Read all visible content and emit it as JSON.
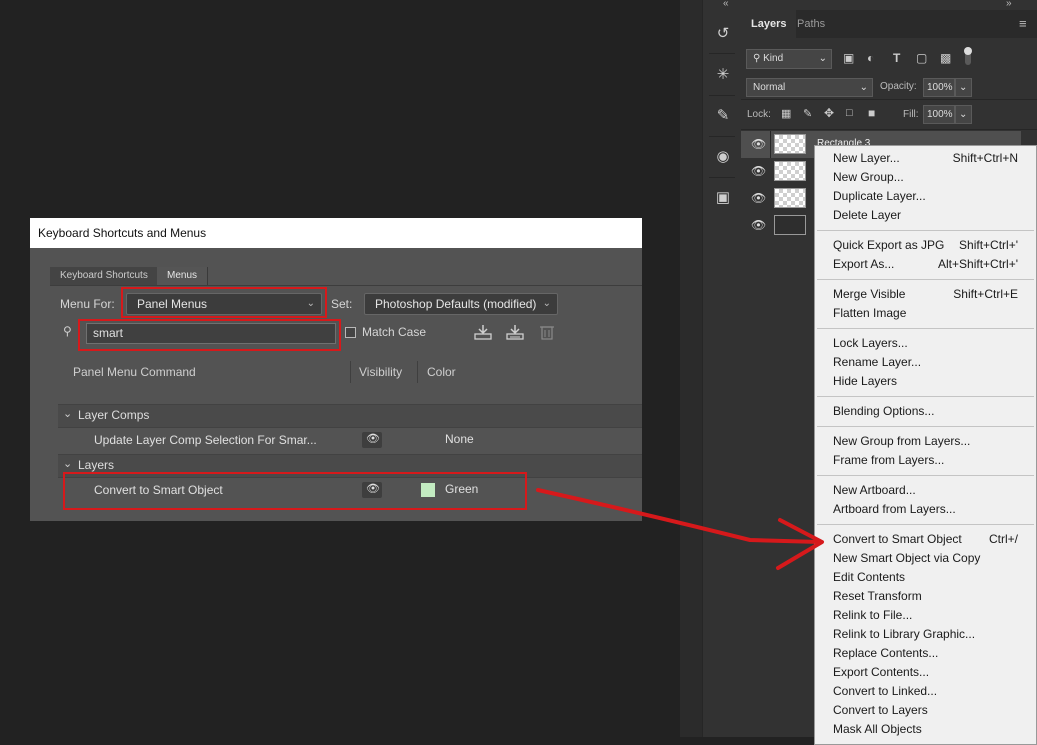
{
  "dialog": {
    "title": "Keyboard Shortcuts and Menus",
    "tabs": [
      "Keyboard Shortcuts",
      "Menus"
    ],
    "menu_for_label": "Menu For:",
    "menu_for_value": "Panel Menus",
    "set_label": "Set:",
    "set_value": "Photoshop Defaults (modified)",
    "search_value": "smart",
    "match_case_label": "Match Case",
    "columns": [
      "Panel Menu Command",
      "Visibility",
      "Color"
    ],
    "groups": [
      {
        "name": "Layer Comps",
        "items": [
          {
            "command": "Update Layer Comp Selection For Smar...",
            "color": "None"
          }
        ]
      },
      {
        "name": "Layers",
        "items": [
          {
            "command": "Convert to Smart Object",
            "color": "Green"
          }
        ]
      }
    ],
    "green_hex": "#c3ebc1",
    "highlight_color": "#d6191b"
  },
  "ps": {
    "tabs": [
      "Layers",
      "Paths"
    ],
    "kind_label": "Kind",
    "blend_mode": "Normal",
    "opacity_label": "Opacity:",
    "opacity_value": "100%",
    "lock_label": "Lock:",
    "fill_label": "Fill:",
    "fill_value": "100%",
    "layer_name": "Rectangle 3",
    "collapse_icon": "double-chevron-icon",
    "panel_menu_icon": "hamburger-icon"
  },
  "context_menu": {
    "items": [
      {
        "label": "New Layer...",
        "shortcut": "Shift+Ctrl+N"
      },
      {
        "label": "New Group...",
        "shortcut": ""
      },
      {
        "label": "Duplicate Layer...",
        "shortcut": ""
      },
      {
        "label": "Delete Layer",
        "shortcut": ""
      },
      {
        "label": "Quick Export as JPG",
        "shortcut": "Shift+Ctrl+'"
      },
      {
        "label": "Export As...",
        "shortcut": "Alt+Shift+Ctrl+'"
      },
      {
        "label": "Merge Visible",
        "shortcut": "Shift+Ctrl+E"
      },
      {
        "label": "Flatten Image",
        "shortcut": ""
      },
      {
        "label": "Lock Layers...",
        "shortcut": ""
      },
      {
        "label": "Rename Layer...",
        "shortcut": ""
      },
      {
        "label": "Hide Layers",
        "shortcut": ""
      },
      {
        "label": "Blending Options...",
        "shortcut": ""
      },
      {
        "label": "New Group from Layers...",
        "shortcut": ""
      },
      {
        "label": "Frame from Layers...",
        "shortcut": ""
      },
      {
        "label": "New Artboard...",
        "shortcut": ""
      },
      {
        "label": "Artboard from Layers...",
        "shortcut": ""
      },
      {
        "label": "Convert to Smart Object",
        "shortcut": "Ctrl+/"
      },
      {
        "label": "New Smart Object via Copy",
        "shortcut": ""
      },
      {
        "label": "Edit Contents",
        "shortcut": ""
      },
      {
        "label": "Reset Transform",
        "shortcut": ""
      },
      {
        "label": "Relink to File...",
        "shortcut": ""
      },
      {
        "label": "Relink to Library Graphic...",
        "shortcut": ""
      },
      {
        "label": "Replace Contents...",
        "shortcut": ""
      },
      {
        "label": "Export Contents...",
        "shortcut": ""
      },
      {
        "label": "Convert to Linked...",
        "shortcut": ""
      },
      {
        "label": "Convert to Layers",
        "shortcut": ""
      },
      {
        "label": "Mask All Objects",
        "shortcut": ""
      }
    ]
  }
}
